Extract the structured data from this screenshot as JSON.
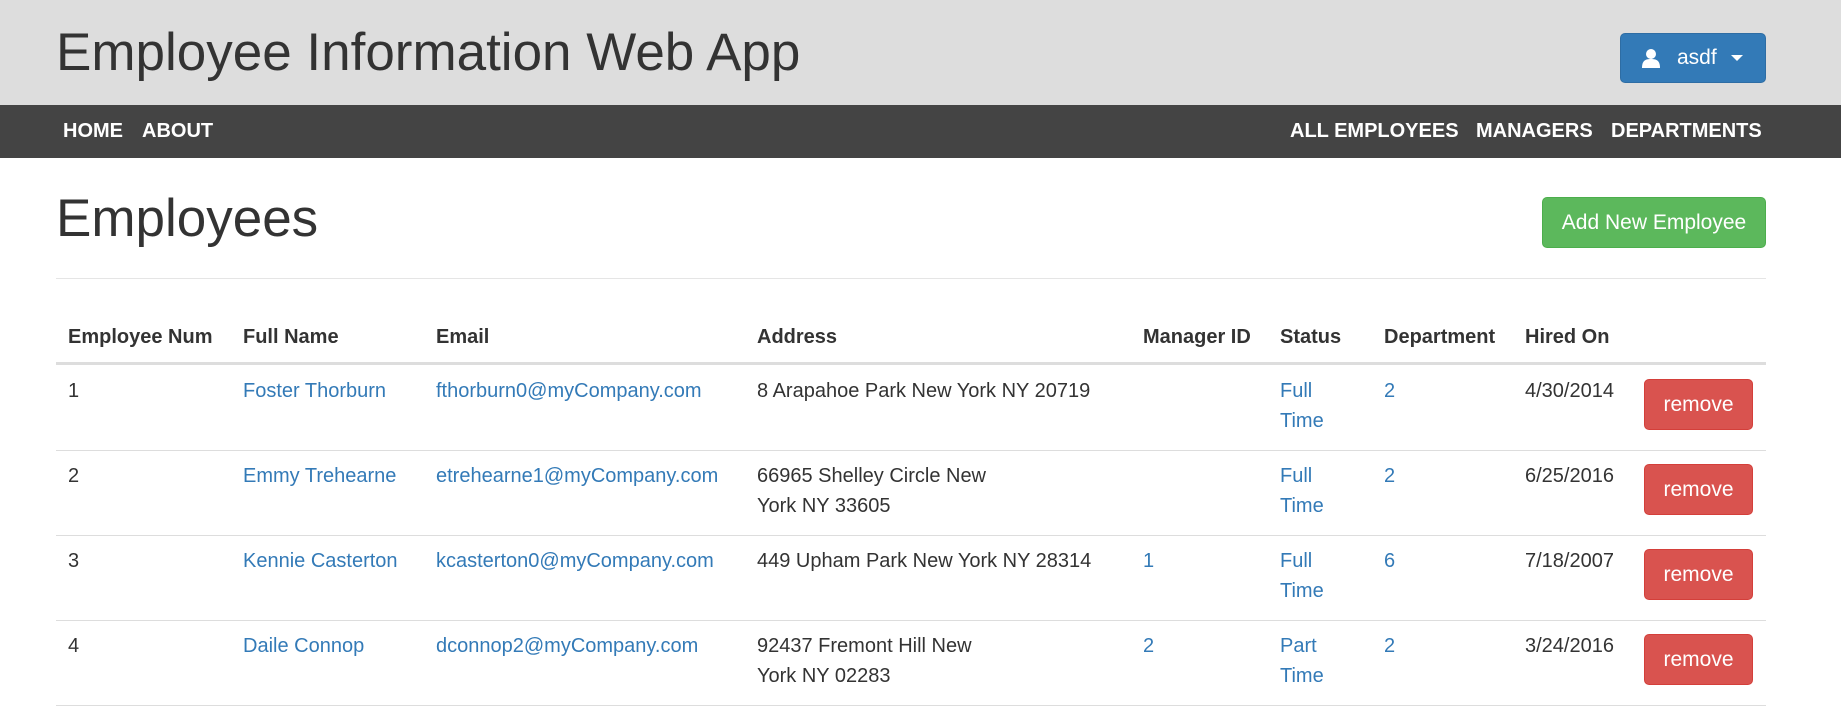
{
  "header": {
    "title": "Employee Information Web App",
    "user_menu": {
      "label": "asdf",
      "icon": "user-icon"
    }
  },
  "nav": {
    "left": [
      "HOME",
      "ABOUT"
    ],
    "right": [
      "ALL EMPLOYEES",
      "MANAGERS",
      "DEPARTMENTS"
    ]
  },
  "main": {
    "title": "Employees",
    "add_button": "Add New Employee"
  },
  "table": {
    "columns": [
      "Employee Num",
      "Full Name",
      "Email",
      "Address",
      "Manager ID",
      "Status",
      "Department",
      "Hired On"
    ],
    "rows": [
      {
        "num": "1",
        "name": "Foster Thorburn",
        "email": "fthorburn0@myCompany.com",
        "address_line1": "8 Arapahoe Park New York NY 20719",
        "address_line2": "",
        "manager": "",
        "status_line1": "Full",
        "status_line2": "Time",
        "department": "2",
        "hired": "4/30/2014",
        "action": "remove"
      },
      {
        "num": "2",
        "name": "Emmy Trehearne",
        "email": "etrehearne1@myCompany.com",
        "address_line1": "66965 Shelley Circle New",
        "address_line2": "York NY 33605",
        "manager": "",
        "status_line1": "Full",
        "status_line2": "Time",
        "department": "2",
        "hired": "6/25/2016",
        "action": "remove"
      },
      {
        "num": "3",
        "name": "Kennie Casterton",
        "email": "kcasterton0@myCompany.com",
        "address_line1": "449 Upham Park New York NY 28314",
        "address_line2": "",
        "manager": "1",
        "status_line1": "Full",
        "status_line2": "Time",
        "department": "6",
        "hired": "7/18/2007",
        "action": "remove"
      },
      {
        "num": "4",
        "name": "Daile Connop",
        "email": "dconnop2@myCompany.com",
        "address_line1": "92437 Fremont Hill New",
        "address_line2": "York NY 02283",
        "manager": "2",
        "status_line1": "Part",
        "status_line2": "Time",
        "department": "2",
        "hired": "3/24/2016",
        "action": "remove"
      }
    ]
  },
  "colors": {
    "header_bg": "#dddddd",
    "navbar_bg": "#444444",
    "primary": "#337ab7",
    "success": "#5cb85c",
    "danger": "#d9534f",
    "link": "#337ab7"
  }
}
